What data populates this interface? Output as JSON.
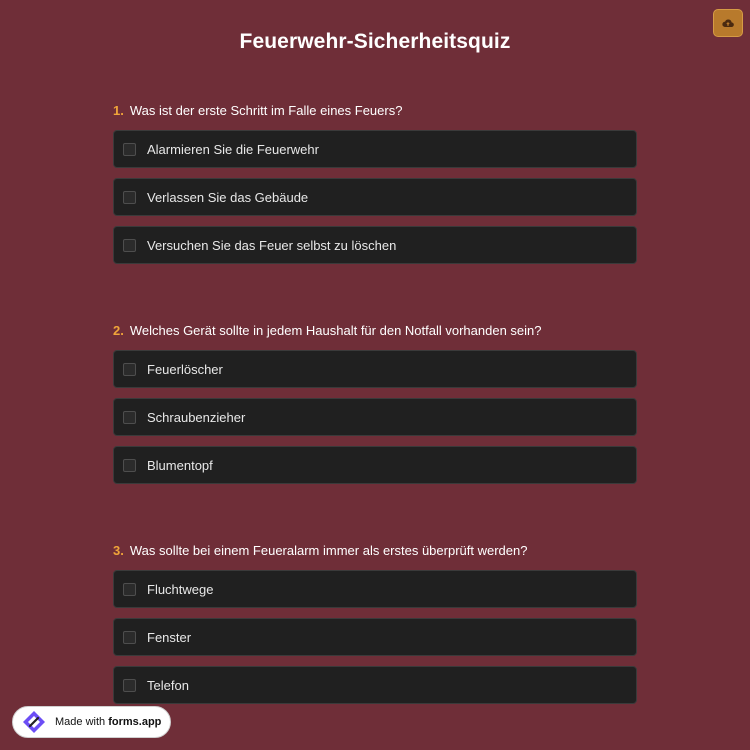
{
  "title": "Feuerwehr-Sicherheitsquiz",
  "upload_icon": "cloud-upload-icon",
  "colors": {
    "background": "#6f2e38",
    "accent": "#f0a53a",
    "option_bg": "#202020",
    "upload_button": "#b87a2c"
  },
  "questions": [
    {
      "number": "1.",
      "text": "Was ist der erste Schritt im Falle eines Feuers?",
      "options": [
        "Alarmieren Sie die Feuerwehr",
        "Verlassen Sie das Gebäude",
        "Versuchen Sie das Feuer selbst zu löschen"
      ]
    },
    {
      "number": "2.",
      "text": "Welches Gerät sollte in jedem Haushalt für den Notfall vorhanden sein?",
      "options": [
        "Feuerlöscher",
        "Schraubenzieher",
        "Blumentopf"
      ]
    },
    {
      "number": "3.",
      "text": "Was sollte bei einem Feueralarm immer als erstes überprüft werden?",
      "options": [
        "Fluchtwege",
        "Fenster",
        "Telefon"
      ]
    }
  ],
  "badge": {
    "prefix": "Made with",
    "brand": "forms.app",
    "icon": "forms-app-logo-icon"
  }
}
